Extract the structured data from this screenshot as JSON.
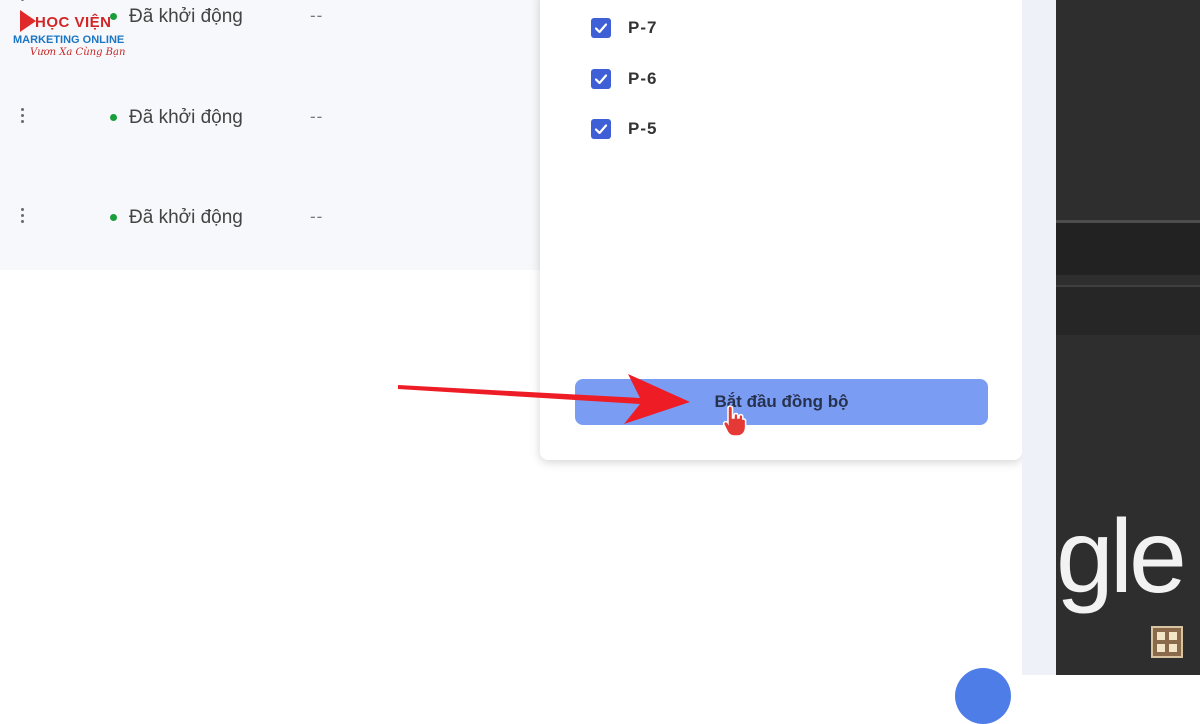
{
  "logo": {
    "title": "HỌC VIỆN",
    "subtitle": "MARKETING ONLINE",
    "tagline": "Vươn Xa Cùng Bạn"
  },
  "rows": [
    {
      "status": "Đã khởi động",
      "extra": "--",
      "status_color": "#1a9e3a"
    },
    {
      "status": "Đã khởi động",
      "extra": "--",
      "status_color": "#1a9e3a"
    },
    {
      "status": "Đã khởi động",
      "extra": "--",
      "status_color": "#1a9e3a"
    }
  ],
  "dialog": {
    "items": [
      {
        "label": "P-7",
        "checked": true
      },
      {
        "label": "P-6",
        "checked": true
      },
      {
        "label": "P-5",
        "checked": true
      }
    ],
    "start_button_label": "Bắt đầu đồng bộ"
  },
  "background": {
    "brand_fragment": "gle"
  },
  "colors": {
    "checkbox": "#3e5fd6",
    "button": "#7b9cf3",
    "annotation_arrow": "#ee1c25"
  },
  "icons": {
    "row_menu": "kebab-menu-icon",
    "checkbox": "checkmark-icon",
    "cursor": "hand-pointer-cursor-icon",
    "annotation": "red-arrow-annotation"
  }
}
